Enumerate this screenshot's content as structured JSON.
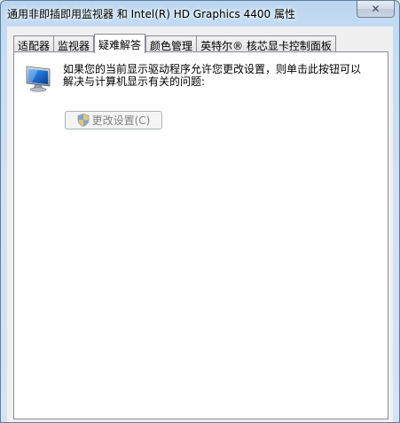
{
  "window": {
    "title": "通用非即插即用监视器 和 Intel(R) HD Graphics 4400 属性",
    "close_symbol": "✕"
  },
  "tabs": [
    {
      "label": "适配器",
      "active": false
    },
    {
      "label": "监视器",
      "active": false
    },
    {
      "label": "疑难解答",
      "active": true
    },
    {
      "label": "颜色管理",
      "active": false
    },
    {
      "label": "英特尔® 核芯显卡控制面板",
      "active": false
    }
  ],
  "troubleshoot": {
    "message": "如果您的当前显示驱动程序允许您更改设置，则单击此按钮可以解决与计算机显示有关的问题:",
    "change_button_label": "更改设置(C)",
    "change_button_enabled": false,
    "icons": {
      "monitor": "monitor-icon",
      "shield": "uac-shield-icon"
    }
  }
}
